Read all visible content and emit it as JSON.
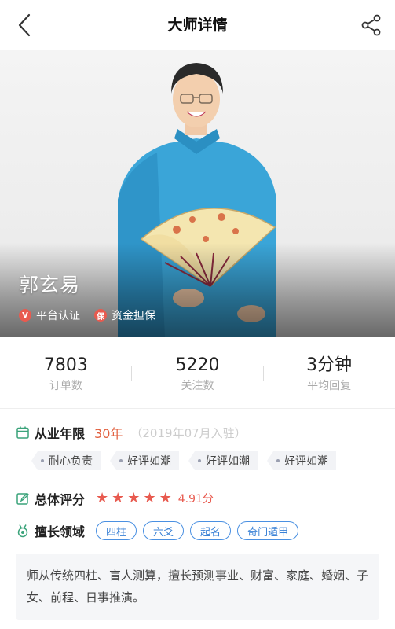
{
  "header": {
    "title": "大师详情",
    "back_icon": "chevron-left-icon",
    "share_icon": "share-icon"
  },
  "hero": {
    "name": "郭玄易",
    "badges": [
      {
        "icon": "v-badge-icon",
        "icon_text": "V",
        "label": "平台认证"
      },
      {
        "icon": "guarantee-badge-icon",
        "icon_text": "保",
        "label": "资金担保"
      }
    ]
  },
  "stats": [
    {
      "value": "7803",
      "label": "订单数"
    },
    {
      "value": "5220",
      "label": "关注数"
    },
    {
      "value": "3分钟",
      "label": "平均回复"
    }
  ],
  "experience": {
    "title": "从业年限",
    "years": "30年",
    "joined": "（2019年07月入驻）",
    "tags": [
      "耐心负责",
      "好评如潮",
      "好评如潮",
      "好评如潮"
    ]
  },
  "rating": {
    "title": "总体评分",
    "stars": 5,
    "score": "4.91分"
  },
  "specialty": {
    "title": "擅长领域",
    "skills": [
      "四柱",
      "六爻",
      "起名",
      "奇门遁甲"
    ]
  },
  "description": "师从传统四柱、盲人测算，擅长预测事业、财富、家庭、婚姻、子女、前程、日事推演。",
  "colors": {
    "accent_red": "#e85a4f",
    "years_orange": "#e2603f",
    "skill_blue": "#3b82d6",
    "icon_green": "#3aa37a"
  }
}
